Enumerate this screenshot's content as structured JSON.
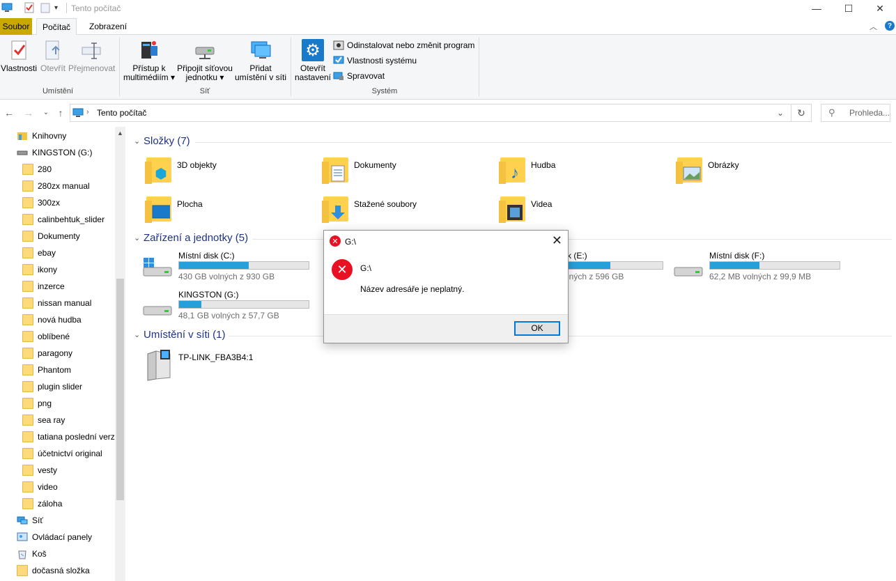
{
  "window": {
    "title": "Tento počítač"
  },
  "tabs": {
    "file": "Soubor",
    "computer": "Počítač",
    "view": "Zobrazení"
  },
  "ribbon": {
    "location_group": "Umístění",
    "network_group": "Síť",
    "system_group": "Systém",
    "properties": "Vlastnosti",
    "open": "Otevřít",
    "rename": "Přejmenovat",
    "media_line1": "Přístup k",
    "media_line2": "multimédiím",
    "map_line1": "Připojit síťovou",
    "map_line2": "jednotku",
    "addloc_line1": "Přidat",
    "addloc_line2": "umístění v síti",
    "settings_line1": "Otevřít",
    "settings_line2": "nastavení",
    "uninstall": "Odinstalovat nebo změnit program",
    "sysprops": "Vlastnosti systému",
    "manage": "Spravovat"
  },
  "address": {
    "path": "Tento počítač",
    "search_placeholder": "Prohleda..."
  },
  "sidebar": {
    "items": [
      "Knihovny",
      "KINGSTON (G:)",
      "280",
      "280zx manual",
      "300zx",
      "calinbehtuk_slider",
      "Dokumenty",
      "ebay",
      "ikony",
      "inzerce",
      "nissan manual",
      "nová hudba",
      "oblíbené",
      "paragony",
      "Phantom",
      "plugin slider",
      "png",
      "sea ray",
      "tatiana poslední verze",
      "účetnictví original",
      "vesty",
      "video",
      "záloha",
      "Síť",
      "Ovládací panely",
      "Koš",
      "dočasná složka"
    ]
  },
  "content": {
    "folders_header": "Složky (7)",
    "folders": [
      "3D objekty",
      "Dokumenty",
      "Hudba",
      "Obrázky",
      "Plocha",
      "Stažené soubory",
      "Videa"
    ],
    "devices_header": "Zařízení a jednotky (5)",
    "drives": [
      {
        "name": "Místní disk (C:)",
        "free": "430 GB volných z 930 GB",
        "used": 0.54
      },
      {
        "name": "k (E:)",
        "free": "lných z 596 GB",
        "used": 0.45
      },
      {
        "name": "Místní disk (F:)",
        "free": "62,2 MB volných z 99,9 MB",
        "used": 0.38
      },
      {
        "name": "KINGSTON (G:)",
        "free": "48,1 GB volných z 57,7 GB",
        "used": 0.17
      }
    ],
    "network_header": "Umístění v síti (1)",
    "network_items": [
      "TP-LINK_FBA3B4:1"
    ]
  },
  "dialog": {
    "title": "G:\\",
    "heading": "G:\\",
    "message": "Název adresáře je neplatný.",
    "ok": "OK"
  },
  "colors": {
    "accent": "#0078d7",
    "progress": "#26a0da",
    "header_text": "#1e3287",
    "error": "#e81123"
  }
}
